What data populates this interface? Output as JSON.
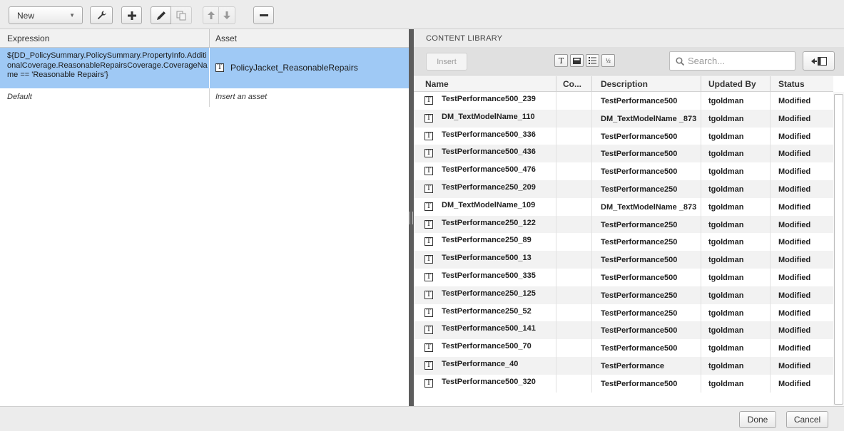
{
  "toolbar": {
    "new_label": "New",
    "buttons": [
      "wrench-icon",
      "plus-icon",
      "pencil-icon",
      "copy-icon",
      "arrow-up-icon",
      "arrow-down-icon",
      "minus-icon"
    ]
  },
  "rules_table": {
    "headers": {
      "expression": "Expression",
      "asset": "Asset"
    },
    "selected_row": {
      "expression": "${DD_PolicySummary.PolicySummary.PropertyInfo.AdditionalCoverage.ReasonableRepairsCoverage.CoverageName == 'Reasonable Repairs'}",
      "asset": "PolicyJacket_ReasonableRepairs",
      "asset_icon": "T"
    },
    "default_row": {
      "expression": "Default",
      "asset": "Insert an asset"
    }
  },
  "content_library": {
    "title": "CONTENT LIBRARY",
    "insert_label": "Insert",
    "view_icons": [
      "text-view-icon",
      "image-view-icon",
      "list-view-icon",
      "fraction-view-icon"
    ],
    "search_placeholder": "Search...",
    "headers": {
      "name": "Name",
      "co": "Co...",
      "description": "Description",
      "updated_by": "Updated By",
      "status": "Status"
    },
    "rows": [
      {
        "icon": "T",
        "name": "TestPerformance500_239",
        "description": "TestPerformance500",
        "updated_by": "tgoldman",
        "status": "Modified"
      },
      {
        "icon": "T",
        "name": "DM_TextModelName_110",
        "description": "DM_TextModelName _873",
        "updated_by": "tgoldman",
        "status": "Modified"
      },
      {
        "icon": "T",
        "name": "TestPerformance500_336",
        "description": "TestPerformance500",
        "updated_by": "tgoldman",
        "status": "Modified"
      },
      {
        "icon": "T",
        "name": "TestPerformance500_436",
        "description": "TestPerformance500",
        "updated_by": "tgoldman",
        "status": "Modified"
      },
      {
        "icon": "T",
        "name": "TestPerformance500_476",
        "description": "TestPerformance500",
        "updated_by": "tgoldman",
        "status": "Modified"
      },
      {
        "icon": "T",
        "name": "TestPerformance250_209",
        "description": "TestPerformance250",
        "updated_by": "tgoldman",
        "status": "Modified"
      },
      {
        "icon": "T",
        "name": "DM_TextModelName_109",
        "description": "DM_TextModelName _873",
        "updated_by": "tgoldman",
        "status": "Modified"
      },
      {
        "icon": "T",
        "name": "TestPerformance250_122",
        "description": "TestPerformance250",
        "updated_by": "tgoldman",
        "status": "Modified"
      },
      {
        "icon": "T",
        "name": "TestPerformance250_89",
        "description": "TestPerformance250",
        "updated_by": "tgoldman",
        "status": "Modified"
      },
      {
        "icon": "T",
        "name": "TestPerformance500_13",
        "description": "TestPerformance500",
        "updated_by": "tgoldman",
        "status": "Modified"
      },
      {
        "icon": "T",
        "name": "TestPerformance500_335",
        "description": "TestPerformance500",
        "updated_by": "tgoldman",
        "status": "Modified"
      },
      {
        "icon": "T",
        "name": "TestPerformance250_125",
        "description": "TestPerformance250",
        "updated_by": "tgoldman",
        "status": "Modified"
      },
      {
        "icon": "T",
        "name": "TestPerformance250_52",
        "description": "TestPerformance250",
        "updated_by": "tgoldman",
        "status": "Modified"
      },
      {
        "icon": "T",
        "name": "TestPerformance500_141",
        "description": "TestPerformance500",
        "updated_by": "tgoldman",
        "status": "Modified"
      },
      {
        "icon": "T",
        "name": "TestPerformance500_70",
        "description": "TestPerformance500",
        "updated_by": "tgoldman",
        "status": "Modified"
      },
      {
        "icon": "T",
        "name": "TestPerformance_40",
        "description": "TestPerformance",
        "updated_by": "tgoldman",
        "status": "Modified"
      },
      {
        "icon": "T",
        "name": "TestPerformance500_320",
        "description": "TestPerformance500",
        "updated_by": "tgoldman",
        "status": "Modified"
      }
    ]
  },
  "footer": {
    "done_label": "Done",
    "cancel_label": "Cancel"
  }
}
